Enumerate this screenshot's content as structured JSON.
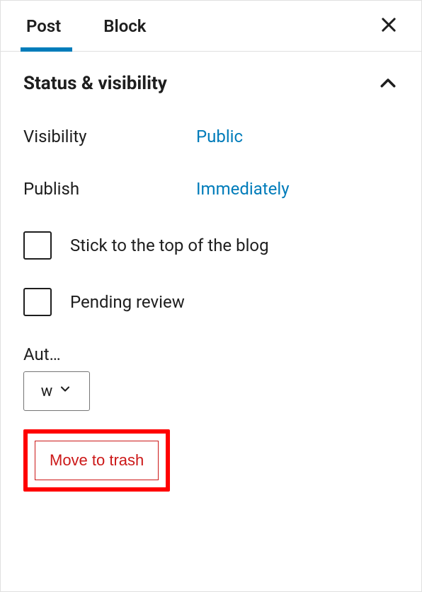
{
  "tabs": {
    "post": "Post",
    "block": "Block"
  },
  "section": {
    "title": "Status & visibility"
  },
  "visibility": {
    "label": "Visibility",
    "value": "Public"
  },
  "publish": {
    "label": "Publish",
    "value": "Immediately"
  },
  "sticky": {
    "label": "Stick to the top of the blog"
  },
  "pending": {
    "label": "Pending review"
  },
  "author": {
    "label": "Author",
    "selected": "w"
  },
  "trash": {
    "label": "Move to trash"
  }
}
